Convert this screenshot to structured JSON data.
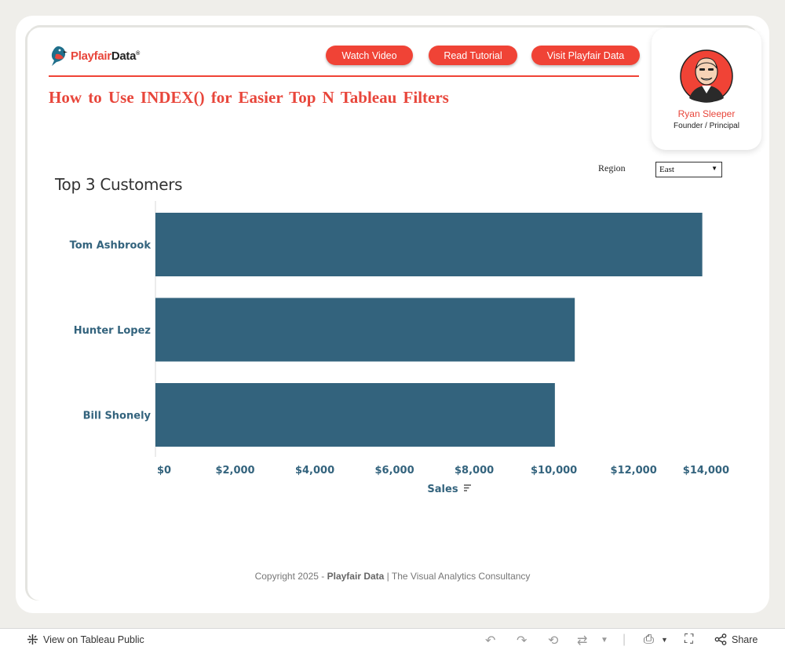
{
  "header": {
    "logo_part1": "Playfair",
    "logo_part2": "Data",
    "logo_reg": "®",
    "buttons": [
      "Watch Video",
      "Read Tutorial",
      "Visit Playfair Data"
    ],
    "title": "How to Use INDEX() for Easier Top N Tableau Filters"
  },
  "profile": {
    "name": "Ryan Sleeper",
    "role": "Founder / Principal"
  },
  "filter": {
    "label": "Region",
    "value": "East"
  },
  "chart_data": {
    "type": "bar",
    "orientation": "horizontal",
    "title": "Top 3 Customers",
    "categories": [
      "Tom Ashbrook",
      "Hunter Lopez",
      "Bill Shonely"
    ],
    "values": [
      13723,
      10523,
      10024
    ],
    "xlabel": "Sales",
    "ylabel": "",
    "xlim": [
      0,
      14400
    ],
    "xticks": [
      0,
      2000,
      4000,
      6000,
      8000,
      10000,
      12000,
      14000
    ],
    "xtick_labels": [
      "$0",
      "$2,000",
      "$4,000",
      "$6,000",
      "$8,000",
      "$10,000",
      "$12,000",
      "$14,000"
    ],
    "bar_color": "#33637d",
    "label_color": "#33637d",
    "grid": false
  },
  "copyright": {
    "prefix": "Copyright 2025 - ",
    "brand": "Playfair Data",
    "suffix": " | The Visual Analytics Consultancy"
  },
  "footer": {
    "view_label": "View on Tableau Public",
    "share_label": "Share"
  },
  "colors": {
    "accent": "#f04336",
    "background": "#efeeea"
  }
}
